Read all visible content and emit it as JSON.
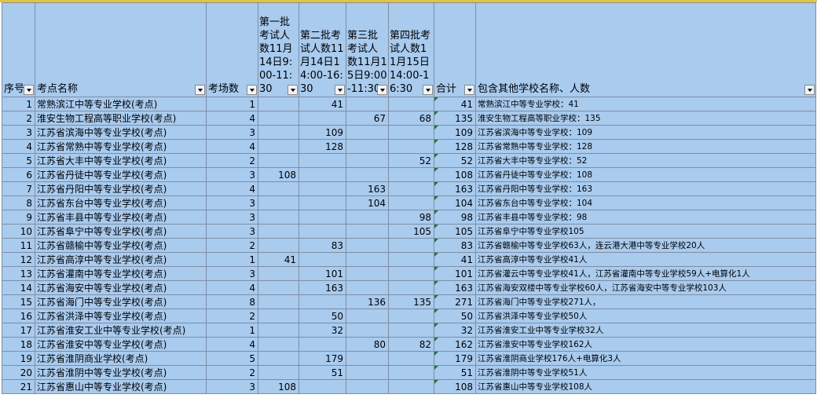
{
  "sheet": {
    "headers": {
      "seq": "序号",
      "name": "考点名称",
      "rooms": "考场数",
      "b1": "第一批考试人数11月14日9:00-11:30",
      "b2": "第二批考试人数11月14日14:00-16:30",
      "b3": "第三批考试人数11月15日9:00-11:30",
      "b4": "第四批考试人数11月15日14:00-16:30",
      "total": "合计",
      "includes": "包含其他学校名称、人数"
    },
    "rows": [
      {
        "seq": "1",
        "name": "常熟滨江中等专业学校(考点)",
        "rooms": "1",
        "b1": "",
        "b2": "41",
        "b3": "",
        "b4": "",
        "total": "41",
        "includes": "常熟滨江中等专业学校：41"
      },
      {
        "seq": "2",
        "name": "淮安生物工程高等职业学校(考点)",
        "rooms": "4",
        "b1": "",
        "b2": "",
        "b3": "67",
        "b4": "68",
        "total": "135",
        "includes": "淮安生物工程高等职业学校：135"
      },
      {
        "seq": "3",
        "name": "江苏省滨海中等专业学校(考点)",
        "rooms": "3",
        "b1": "",
        "b2": "109",
        "b3": "",
        "b4": "",
        "total": "109",
        "includes": "江苏省滨海中等专业学校：109"
      },
      {
        "seq": "4",
        "name": "江苏省常熟中等专业学校(考点)",
        "rooms": "4",
        "b1": "",
        "b2": "128",
        "b3": "",
        "b4": "",
        "total": "128",
        "includes": "江苏省常熟中等专业学校：128"
      },
      {
        "seq": "5",
        "name": "江苏省大丰中等专业学校(考点)",
        "rooms": "2",
        "b1": "",
        "b2": "",
        "b3": "",
        "b4": "52",
        "total": "52",
        "includes": "江苏省大丰中等专业学校：52"
      },
      {
        "seq": "6",
        "name": "江苏省丹徒中等专业学校(考点)",
        "rooms": "3",
        "b1": "108",
        "b2": "",
        "b3": "",
        "b4": "",
        "total": "108",
        "includes": "江苏省丹徒中等专业学校：108"
      },
      {
        "seq": "7",
        "name": "江苏省丹阳中等专业学校(考点)",
        "rooms": "4",
        "b1": "",
        "b2": "",
        "b3": "163",
        "b4": "",
        "total": "163",
        "includes": "江苏省丹阳中等专业学校：163"
      },
      {
        "seq": "8",
        "name": "江苏省东台中等专业学校(考点)",
        "rooms": "3",
        "b1": "",
        "b2": "",
        "b3": "104",
        "b4": "",
        "total": "104",
        "includes": "江苏省东台中等专业学校：104"
      },
      {
        "seq": "9",
        "name": "江苏省丰县中等专业学校(考点)",
        "rooms": "3",
        "b1": "",
        "b2": "",
        "b3": "",
        "b4": "98",
        "total": "98",
        "includes": "江苏省丰县中等专业学校：98"
      },
      {
        "seq": "10",
        "name": "江苏省阜宁中等专业学校(考点)",
        "rooms": "3",
        "b1": "",
        "b2": "",
        "b3": "",
        "b4": "105",
        "total": "105",
        "includes": "江苏省阜宁中等专业学校105"
      },
      {
        "seq": "11",
        "name": "江苏省赣榆中等专业学校(考点)",
        "rooms": "2",
        "b1": "",
        "b2": "83",
        "b3": "",
        "b4": "",
        "total": "83",
        "includes": "江苏省赣榆中等专业学校63人，连云港大港中等专业学校20人"
      },
      {
        "seq": "12",
        "name": "江苏省高淳中等专业学校(考点)",
        "rooms": "1",
        "b1": "41",
        "b2": "",
        "b3": "",
        "b4": "",
        "total": "41",
        "includes": "江苏省高淳中等专业学校41人"
      },
      {
        "seq": "13",
        "name": "江苏省灌南中等专业学校(考点)",
        "rooms": "3",
        "b1": "",
        "b2": "101",
        "b3": "",
        "b4": "",
        "total": "101",
        "includes": "江苏省灌云中等专业学校41人，江苏省灌南中等专业学校59人+电算化1人"
      },
      {
        "seq": "14",
        "name": "江苏省海安中等专业学校(考点)",
        "rooms": "4",
        "b1": "",
        "b2": "163",
        "b3": "",
        "b4": "",
        "total": "163",
        "includes": "江苏省海安双楼中等专业学校60人，江苏省海安中等专业学校103人"
      },
      {
        "seq": "15",
        "name": "江苏省海门中等专业学校(考点)",
        "rooms": "8",
        "b1": "",
        "b2": "",
        "b3": "136",
        "b4": "135",
        "total": "271",
        "includes": "江苏省海门中等专业学校271人，"
      },
      {
        "seq": "16",
        "name": "江苏省洪泽中等专业学校(考点)",
        "rooms": "2",
        "b1": "",
        "b2": "50",
        "b3": "",
        "b4": "",
        "total": "50",
        "includes": "江苏省洪泽中等专业学校50人"
      },
      {
        "seq": "17",
        "name": "江苏省淮安工业中等专业学校(考点)",
        "rooms": "1",
        "b1": "",
        "b2": "32",
        "b3": "",
        "b4": "",
        "total": "32",
        "includes": "江苏省淮安工业中等专业学校32人"
      },
      {
        "seq": "18",
        "name": "江苏省淮安中等专业学校(考点)",
        "rooms": "4",
        "b1": "",
        "b2": "",
        "b3": "80",
        "b4": "82",
        "total": "162",
        "includes": "江苏省淮安中等专业学校162人"
      },
      {
        "seq": "19",
        "name": "江苏省淮阴商业学校(考点)",
        "rooms": "5",
        "b1": "",
        "b2": "179",
        "b3": "",
        "b4": "",
        "total": "179",
        "includes": "江苏省淮阴商业学校176人+电算化3人"
      },
      {
        "seq": "20",
        "name": "江苏省淮阴中等专业学校(考点)",
        "rooms": "2",
        "b1": "",
        "b2": "51",
        "b3": "",
        "b4": "",
        "total": "51",
        "includes": "江苏省淮阴中等专业学校51人"
      },
      {
        "seq": "21",
        "name": "江苏省惠山中等专业学校(考点)",
        "rooms": "3",
        "b1": "108",
        "b2": "",
        "b3": "",
        "b4": "",
        "total": "108",
        "includes": "江苏省惠山中等专业学校108人"
      }
    ]
  },
  "colors": {
    "cell_bg": "#a8cbee",
    "grid_line": "#7f8ea3",
    "corner_marker": "#1e7a2e"
  }
}
